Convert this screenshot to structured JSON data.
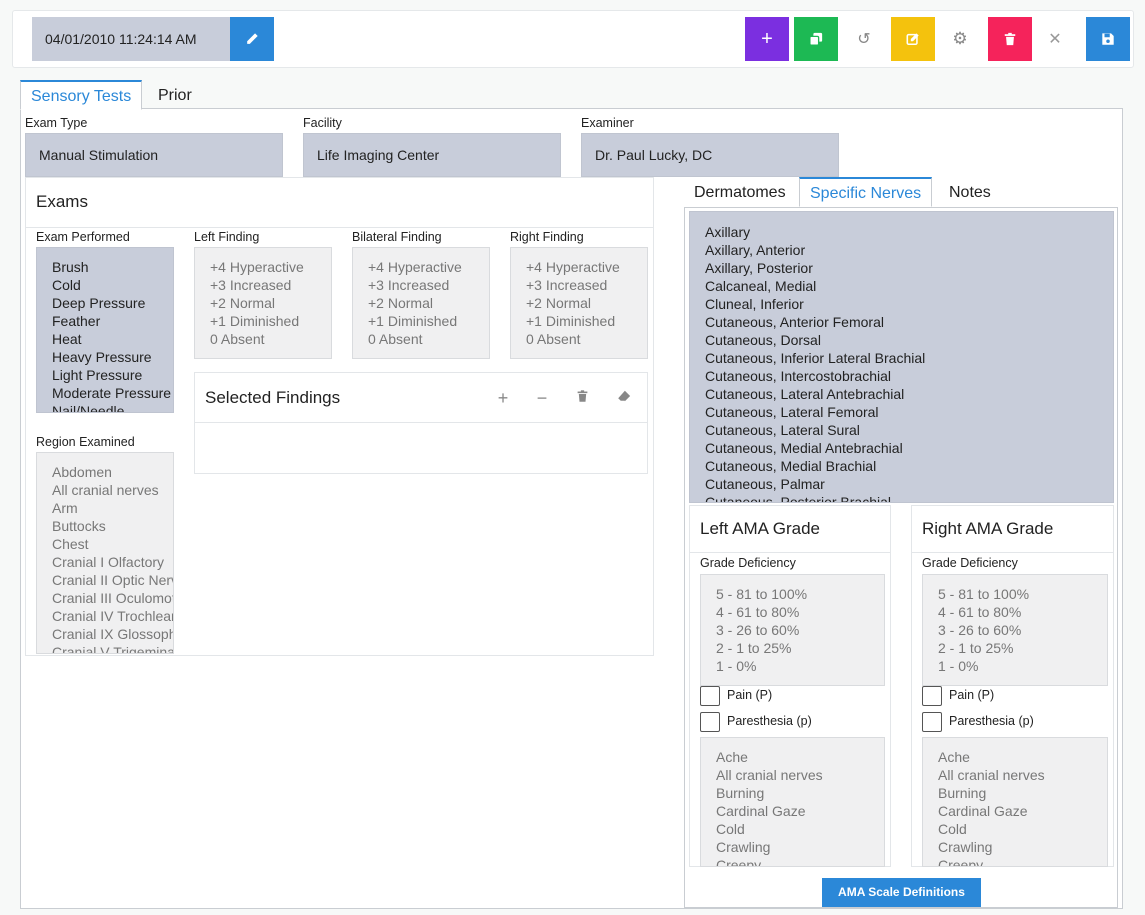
{
  "toolbar": {
    "datetime": "04/01/2010 11:24:14 AM",
    "colors": {
      "add": "#7b2fe0",
      "copy": "#1db954",
      "edit": "#f4c20d",
      "delete": "#f5235b",
      "save": "#2b88d8",
      "pencil": "#2b88d8"
    },
    "icons": [
      "pencil-icon",
      "plus-icon",
      "copy-icon",
      "undo-icon",
      "edit-icon",
      "gear-icon",
      "trash-icon",
      "close-icon",
      "save-icon"
    ]
  },
  "tabs": {
    "sensory": "Sensory Tests",
    "prior": "Prior"
  },
  "header_fields": {
    "exam_type": {
      "label": "Exam Type",
      "value": "Manual Stimulation"
    },
    "facility": {
      "label": "Facility",
      "value": "Life Imaging Center"
    },
    "examiner": {
      "label": "Examiner",
      "value": "Dr. Paul Lucky, DC"
    }
  },
  "exams": {
    "title": "Exams",
    "exam_performed": {
      "label": "Exam Performed",
      "items": [
        "Brush",
        "Cold",
        "Deep Pressure",
        "Feather",
        "Heat",
        "Heavy Pressure",
        "Light Pressure",
        "Moderate Pressure",
        "Nail/Needle"
      ]
    },
    "left_finding": {
      "label": "Left Finding",
      "items": [
        "+4 Hyperactive",
        "+3 Increased",
        "+2 Normal",
        "+1 Diminished",
        "0 Absent"
      ]
    },
    "bilateral_finding": {
      "label": "Bilateral Finding",
      "items": [
        "+4 Hyperactive",
        "+3 Increased",
        "+2 Normal",
        "+1 Diminished",
        "0 Absent"
      ]
    },
    "right_finding": {
      "label": "Right Finding",
      "items": [
        "+4 Hyperactive",
        "+3 Increased",
        "+2 Normal",
        "+1 Diminished",
        "0 Absent"
      ]
    },
    "region_examined": {
      "label": "Region Examined",
      "items": [
        "Abdomen",
        "All cranial nerves",
        "Arm",
        "Buttocks",
        "Chest",
        "Cranial I Olfactory",
        "Cranial II Optic Nerve",
        "Cranial III Oculomotor",
        "Cranial IV Trochlear",
        "Cranial IX Glossopharyngeal",
        "Cranial V Trigeminal"
      ]
    },
    "selected_findings": {
      "title": "Selected Findings"
    }
  },
  "right_tabs": {
    "dermatomes": "Dermatomes",
    "specific_nerves": "Specific Nerves",
    "notes": "Notes"
  },
  "nerves": [
    "Axillary",
    "Axillary, Anterior",
    "Axillary, Posterior",
    "Calcaneal, Medial",
    "Cluneal, Inferior",
    "Cutaneous, Anterior Femoral",
    "Cutaneous, Dorsal",
    "Cutaneous, Inferior Lateral Brachial",
    "Cutaneous, Intercostobrachial",
    "Cutaneous, Lateral Antebrachial",
    "Cutaneous, Lateral Femoral",
    "Cutaneous, Lateral Sural",
    "Cutaneous, Medial Antebrachial",
    "Cutaneous, Medial Brachial",
    "Cutaneous, Palmar",
    "Cutaneous, Posterior Brachial"
  ],
  "left_ama": {
    "title": "Left AMA Grade",
    "grade_label": "Grade Deficiency",
    "grades": [
      "5 - 81 to 100%",
      "4 - 61 to 80%",
      "3 - 26 to 60%",
      "2 - 1 to 25%",
      "1 - 0%"
    ],
    "pain": "Pain (P)",
    "paresthesia": "Paresthesia (p)",
    "symptoms": [
      "Ache",
      "All cranial nerves",
      "Burning",
      "Cardinal Gaze",
      "Cold",
      "Crawling",
      "Creepy"
    ]
  },
  "right_ama": {
    "title": "Right AMA Grade",
    "grade_label": "Grade Deficiency",
    "grades": [
      "5 - 81 to 100%",
      "4 - 61 to 80%",
      "3 - 26 to 60%",
      "2 - 1 to 25%",
      "1 - 0%"
    ],
    "pain": "Pain (P)",
    "paresthesia": "Paresthesia (p)",
    "symptoms": [
      "Ache",
      "All cranial nerves",
      "Burning",
      "Cardinal Gaze",
      "Cold",
      "Crawling",
      "Creepy"
    ]
  },
  "ama_button": "AMA Scale Definitions"
}
